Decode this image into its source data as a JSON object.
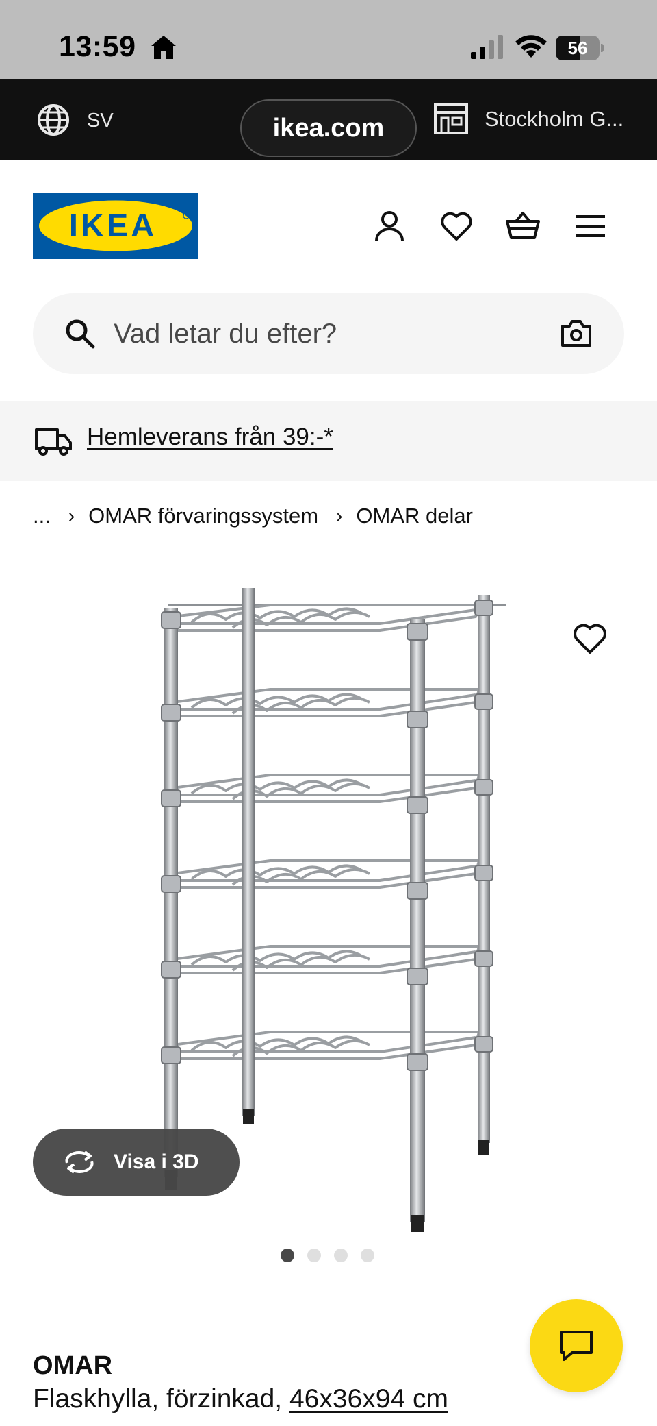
{
  "status_bar": {
    "time": "13:59",
    "battery": "56",
    "battery_level": 0.56
  },
  "browser": {
    "language": "SV",
    "url": "ikea.com",
    "store": "Stockholm G..."
  },
  "header": {
    "logo_text": "IKEA",
    "brand_colors": {
      "blue": "#0058a3",
      "yellow": "#ffdb00"
    },
    "icons": [
      "person-icon",
      "heart-icon",
      "cart-icon",
      "menu-icon"
    ]
  },
  "search": {
    "placeholder": "Vad letar du efter?",
    "value": ""
  },
  "delivery": {
    "text": "Hemleverans från 39:-*"
  },
  "breadcrumb": {
    "ellipsis": "...",
    "items": [
      "OMAR förvaringssystem",
      "OMAR delar"
    ]
  },
  "gallery": {
    "view_3d_label": "Visa i 3D",
    "image_count": 4,
    "active_index": 0
  },
  "product": {
    "name": "OMAR",
    "description": "Flaskhylla, förzinkad, ",
    "dimensions": "46x36x94 cm"
  },
  "colors": {
    "chat_button": "#fbd914",
    "topbar": "#111111",
    "statusbar": "#bdbdbd"
  }
}
